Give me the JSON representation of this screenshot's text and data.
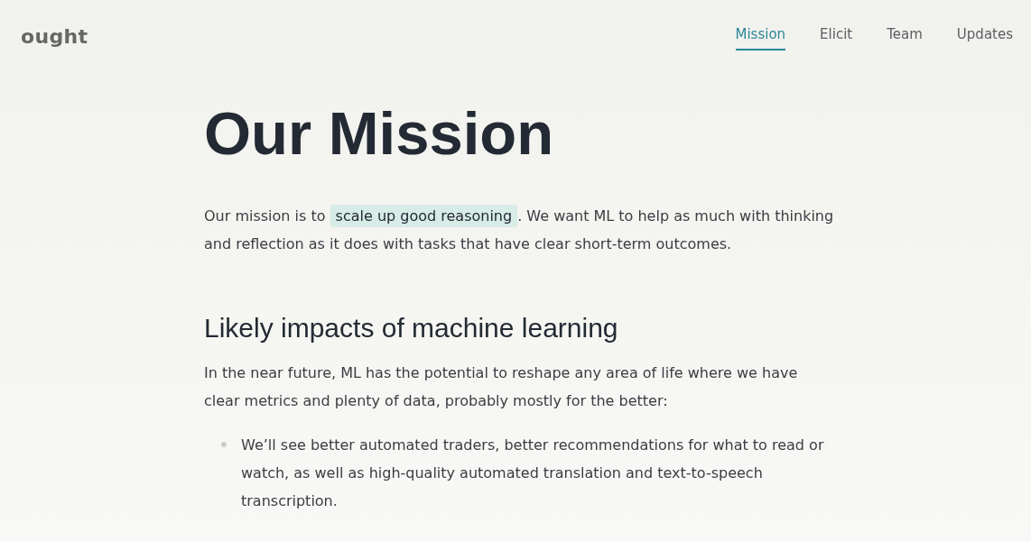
{
  "logo": "ought",
  "nav": [
    {
      "label": "Mission",
      "selected": true
    },
    {
      "label": "Elicit",
      "selected": false
    },
    {
      "label": "Team",
      "selected": false
    },
    {
      "label": "Updates",
      "selected": false
    }
  ],
  "title": "Our Mission",
  "intro": {
    "before": "Our mission is to",
    "link": "scale up good reasoning",
    "after": ". We want ML to help as much with thinking and reflection as it does with tasks that have clear short-term outcomes."
  },
  "section": {
    "heading": "Likely impacts of machine learning",
    "paragraph": "In the near future, ML has the potential to reshape any area of life where we have clear metrics and plenty of data, probably mostly for the better:",
    "bullets": [
      "We’ll see better automated traders, better recommendations for what to read or watch, as well as high-quality automated translation and text-to-speech transcription."
    ]
  }
}
